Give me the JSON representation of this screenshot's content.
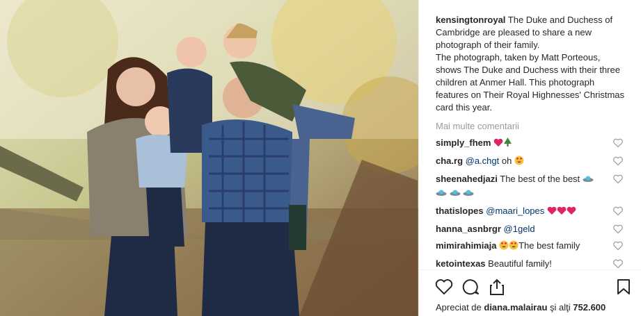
{
  "post": {
    "photo_alt": "Family photo",
    "caption_user": "kensingtonroyal",
    "caption_text": " The Duke and Duchess of Cambridge are pleased to share a new photograph of their family.",
    "caption_text2": "The photograph, taken by Matt Porteous, shows The Duke and Duchess with their three children at Anmer Hall. This photograph features on Their Royal Highnesses' Christmas card this year.",
    "more_comments": "Mai multe comentarii",
    "comments": [
      {
        "user": "simply_fhem",
        "text": ""
      },
      {
        "user": "cha.rg",
        "mention": "@a.chgt",
        "text": " oh "
      },
      {
        "user": "sheenahedjazi",
        "text": " The best of the best "
      },
      {
        "user": "thatislopes",
        "mention": "@maari_lopes",
        "text": " "
      },
      {
        "user": "hanna_asnbrgr",
        "mention": "@1geld",
        "text": ""
      },
      {
        "user": "mimirahimiaja",
        "text": "The best family"
      },
      {
        "user": "ketointexas",
        "text": " Beautiful family!"
      }
    ],
    "likes_prefix": "Apreciat de ",
    "likes_user": "diana.malairau",
    "likes_suffix": " şi alţi ",
    "likes_count": "752.600"
  },
  "colors": {
    "heart_red": "#e0245e",
    "mention": "#003569",
    "muted": "#999999"
  },
  "icons": [
    "heart-icon",
    "comment-icon",
    "share-icon",
    "bookmark-icon"
  ]
}
